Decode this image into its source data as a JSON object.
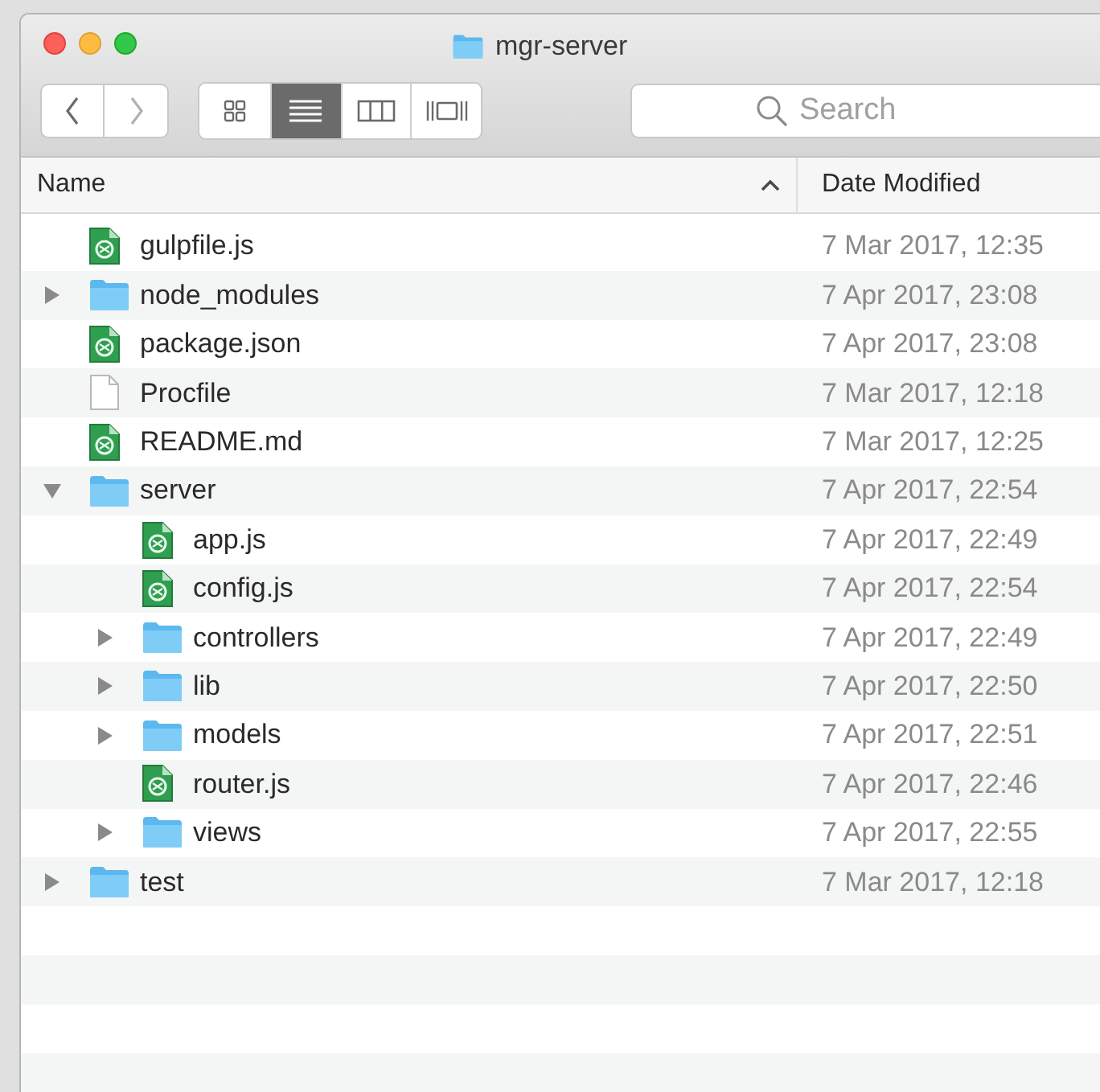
{
  "window": {
    "title": "mgr-server"
  },
  "view_modes": [
    {
      "kind": "icons",
      "selected": false
    },
    {
      "kind": "list",
      "selected": true
    },
    {
      "kind": "columns",
      "selected": false
    },
    {
      "kind": "coverflow",
      "selected": false
    }
  ],
  "search": {
    "placeholder": "Search"
  },
  "columns": [
    {
      "label": "Name",
      "sorted": true
    },
    {
      "label": "Date Modified",
      "sorted": false
    }
  ],
  "files": [
    {
      "name": "gulpfile.js",
      "kind": "script",
      "date": "7 Mar 2017, 12:35"
    },
    {
      "name": "node_modules",
      "kind": "folder",
      "date": "7 Apr 2017, 23:08",
      "expanded": false
    },
    {
      "name": "package.json",
      "kind": "script",
      "date": "7 Apr 2017, 23:08"
    },
    {
      "name": "Procfile",
      "kind": "document",
      "date": "7 Mar 2017, 12:18"
    },
    {
      "name": "README.md",
      "kind": "script",
      "date": "7 Mar 2017, 12:25"
    },
    {
      "name": "server",
      "kind": "folder",
      "date": "7 Apr 2017, 22:54",
      "expanded": true,
      "children": [
        {
          "name": "app.js",
          "kind": "script",
          "date": "7 Apr 2017, 22:49"
        },
        {
          "name": "config.js",
          "kind": "script",
          "date": "7 Apr 2017, 22:54"
        },
        {
          "name": "controllers",
          "kind": "folder",
          "date": "7 Apr 2017, 22:49",
          "expanded": false
        },
        {
          "name": "lib",
          "kind": "folder",
          "date": "7 Apr 2017, 22:50",
          "expanded": false
        },
        {
          "name": "models",
          "kind": "folder",
          "date": "7 Apr 2017, 22:51",
          "expanded": false
        },
        {
          "name": "router.js",
          "kind": "script",
          "date": "7 Apr 2017, 22:46"
        },
        {
          "name": "views",
          "kind": "folder",
          "date": "7 Apr 2017, 22:55",
          "expanded": false
        }
      ]
    },
    {
      "name": "test",
      "kind": "folder",
      "date": "7 Mar 2017, 12:18",
      "expanded": false
    }
  ]
}
